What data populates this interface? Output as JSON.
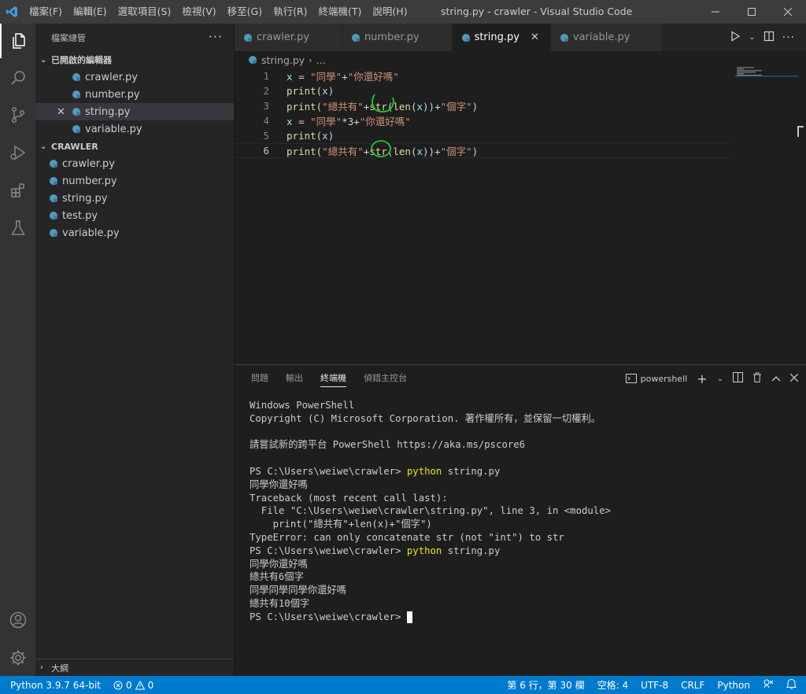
{
  "window": {
    "title": "string.py - crawler - Visual Studio Code",
    "menu": [
      "檔案(F)",
      "編輯(E)",
      "選取項目(S)",
      "檢視(V)",
      "移至(G)",
      "執行(R)",
      "終端機(T)",
      "說明(H)"
    ]
  },
  "sidebar": {
    "title": "檔案總管",
    "open_editors_label": "已開啟的編輯器",
    "open_editors": [
      "crawler.py",
      "number.py",
      "string.py",
      "variable.py"
    ],
    "folder_label": "CRAWLER",
    "files": [
      "crawler.py",
      "number.py",
      "string.py",
      "test.py",
      "variable.py"
    ],
    "outline_label": "大綱"
  },
  "tabs": [
    "crawler.py",
    "number.py",
    "string.py",
    "variable.py"
  ],
  "active_tab": "string.py",
  "breadcrumb": {
    "file": "string.py",
    "rest": "..."
  },
  "code": [
    {
      "n": "1",
      "t": "x = \"同學\"+\"你還好嗎\""
    },
    {
      "n": "2",
      "t": "print(x)"
    },
    {
      "n": "3",
      "t": "print(\"總共有\"+str(len(x))+\"個字\")"
    },
    {
      "n": "4",
      "t": "x = \"同學\"*3+\"你還好嗎\""
    },
    {
      "n": "5",
      "t": "print(x)"
    },
    {
      "n": "6",
      "t": "print(\"總共有\"+str(len(x))+\"個字\")"
    }
  ],
  "panel": {
    "tabs": [
      "問題",
      "輸出",
      "終端機",
      "偵錯主控台"
    ],
    "active": "終端機",
    "shell": "powershell"
  },
  "terminal": {
    "l1": "Windows PowerShell",
    "l2": "Copyright (C) Microsoft Corporation. 著作權所有，並保留一切權利。",
    "l3": "請嘗試新的跨平台 PowerShell https://aka.ms/pscore6",
    "prompt": "PS C:\\Users\\weiwe\\crawler> ",
    "cmd": "python",
    "arg": " string.py",
    "o1": "同學你還好嗎",
    "tb1": "Traceback (most recent call last):",
    "tb2": "  File \"C:\\Users\\weiwe\\crawler\\string.py\", line 3, in <module>",
    "tb3": "    print(\"總共有\"+len(x)+\"個字\")",
    "tb4": "TypeError: can only concatenate str (not \"int\") to str",
    "r1": "同學你還好嗎",
    "r2": "總共有6個字",
    "r3": "同學同學同學你還好嗎",
    "r4": "總共有10個字"
  },
  "status": {
    "python": "Python 3.9.7 64-bit",
    "errors": "0",
    "warnings": "0",
    "position": "第 6 行，第 30 欄",
    "spaces": "空格: 4",
    "encoding": "UTF-8",
    "eol": "CRLF",
    "language": "Python"
  },
  "colors": {
    "accent": "#007acc",
    "annotation_green": "#22c72a",
    "annotation_red": "#e0201b"
  }
}
